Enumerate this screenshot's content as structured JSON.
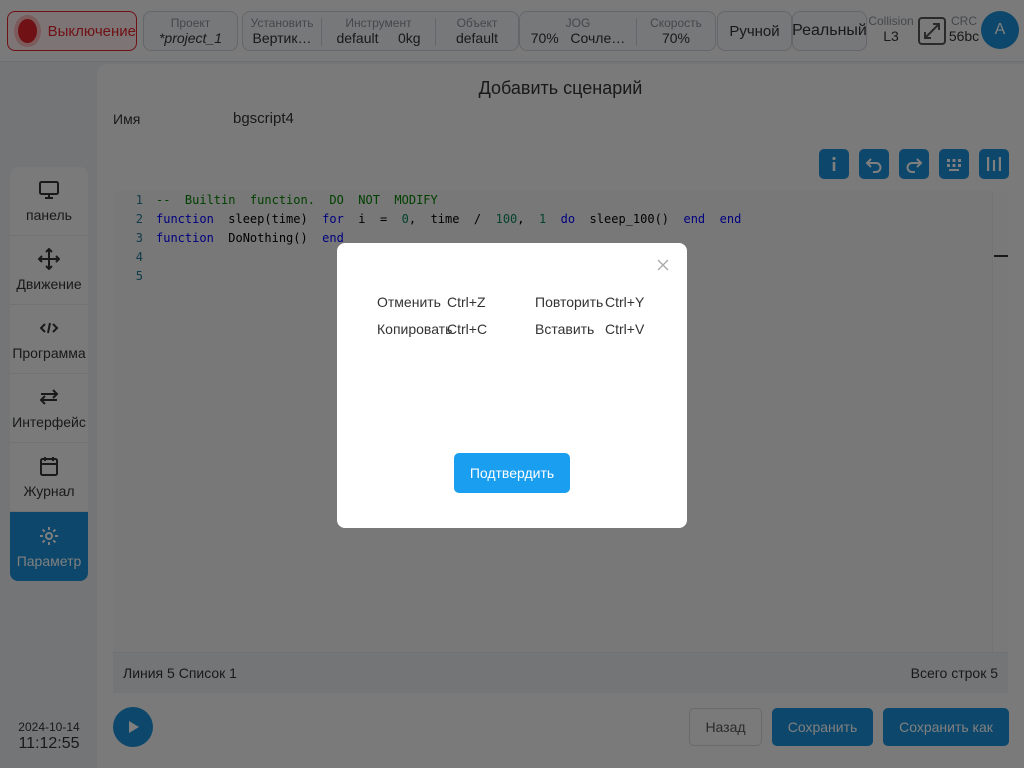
{
  "topbar": {
    "power_label": "Выключение",
    "project": {
      "label": "Проект",
      "value": "*project_1"
    },
    "setup": {
      "label": "Установить",
      "value": "Вертик…"
    },
    "tool": {
      "label": "Инструмент",
      "value_name": "default",
      "value_weight": "0kg"
    },
    "object": {
      "label": "Объект",
      "value": "default"
    },
    "jog": {
      "label": "JOG",
      "value_speed": "70%",
      "value_mode": "Сочле…"
    },
    "speed": {
      "label": "Скорость",
      "value": "70%"
    },
    "manual_label": "Ручной",
    "real_label": "Реальный",
    "collision": {
      "label": "Collision",
      "value": "L3"
    },
    "crc": {
      "label": "CRC",
      "value": "56bc"
    },
    "avatar_letter": "A"
  },
  "sidebar": {
    "items": [
      {
        "label": "панель",
        "icon": "monitor-icon"
      },
      {
        "label": "Движение",
        "icon": "move-icon"
      },
      {
        "label": "Программа",
        "icon": "code-icon"
      },
      {
        "label": "Интерфейс",
        "icon": "swap-icon"
      },
      {
        "label": "Журнал",
        "icon": "calendar-icon"
      },
      {
        "label": "Параметр",
        "icon": "gear-icon",
        "active": true
      }
    ],
    "date": "2024-10-14",
    "time": "11:12:55"
  },
  "main": {
    "title": "Добавить сценарий",
    "name_label": "Имя",
    "name_value": "bgscript4",
    "editor": {
      "lines": [
        {
          "n": "1",
          "tokens": [
            {
              "t": "cm",
              "v": "--  Builtin  function.  DO  NOT  MODIFY"
            }
          ]
        },
        {
          "n": "2",
          "tokens": [
            {
              "t": "kw",
              "v": "function"
            },
            {
              "t": "id",
              "v": "  sleep(time)  "
            },
            {
              "t": "kw",
              "v": "for"
            },
            {
              "t": "id",
              "v": "  i  =  "
            },
            {
              "t": "num",
              "v": "0"
            },
            {
              "t": "id",
              "v": ",  time  /  "
            },
            {
              "t": "num",
              "v": "100"
            },
            {
              "t": "id",
              "v": ",  "
            },
            {
              "t": "num",
              "v": "1"
            },
            {
              "t": "id",
              "v": "  "
            },
            {
              "t": "kw",
              "v": "do"
            },
            {
              "t": "id",
              "v": "  sleep_100()  "
            },
            {
              "t": "kw",
              "v": "end"
            },
            {
              "t": "id",
              "v": "  "
            },
            {
              "t": "kw",
              "v": "end"
            }
          ]
        },
        {
          "n": "3",
          "tokens": [
            {
              "t": "kw",
              "v": "function"
            },
            {
              "t": "id",
              "v": "  DoNothing()  "
            },
            {
              "t": "kw",
              "v": "end"
            }
          ]
        },
        {
          "n": "4",
          "tokens": []
        },
        {
          "n": "5",
          "tokens": []
        }
      ]
    },
    "status_left": "Линия 5 Список 1",
    "status_right": "Всего строк 5",
    "buttons": {
      "back": "Назад",
      "save": "Сохранить",
      "save_as": "Сохранить как"
    }
  },
  "modal": {
    "shortcuts": [
      {
        "action": "Отменить",
        "key": "Ctrl+Z"
      },
      {
        "action": "Повторить",
        "key": "Ctrl+Y"
      },
      {
        "action": "Копировать",
        "key": "Ctrl+C"
      },
      {
        "action": "Вставить",
        "key": "Ctrl+V"
      }
    ],
    "confirm": "Подтвердить"
  },
  "colors": {
    "accent": "#1a8fd6",
    "power": "#e0242b",
    "confirm": "#1a9ef0"
  }
}
